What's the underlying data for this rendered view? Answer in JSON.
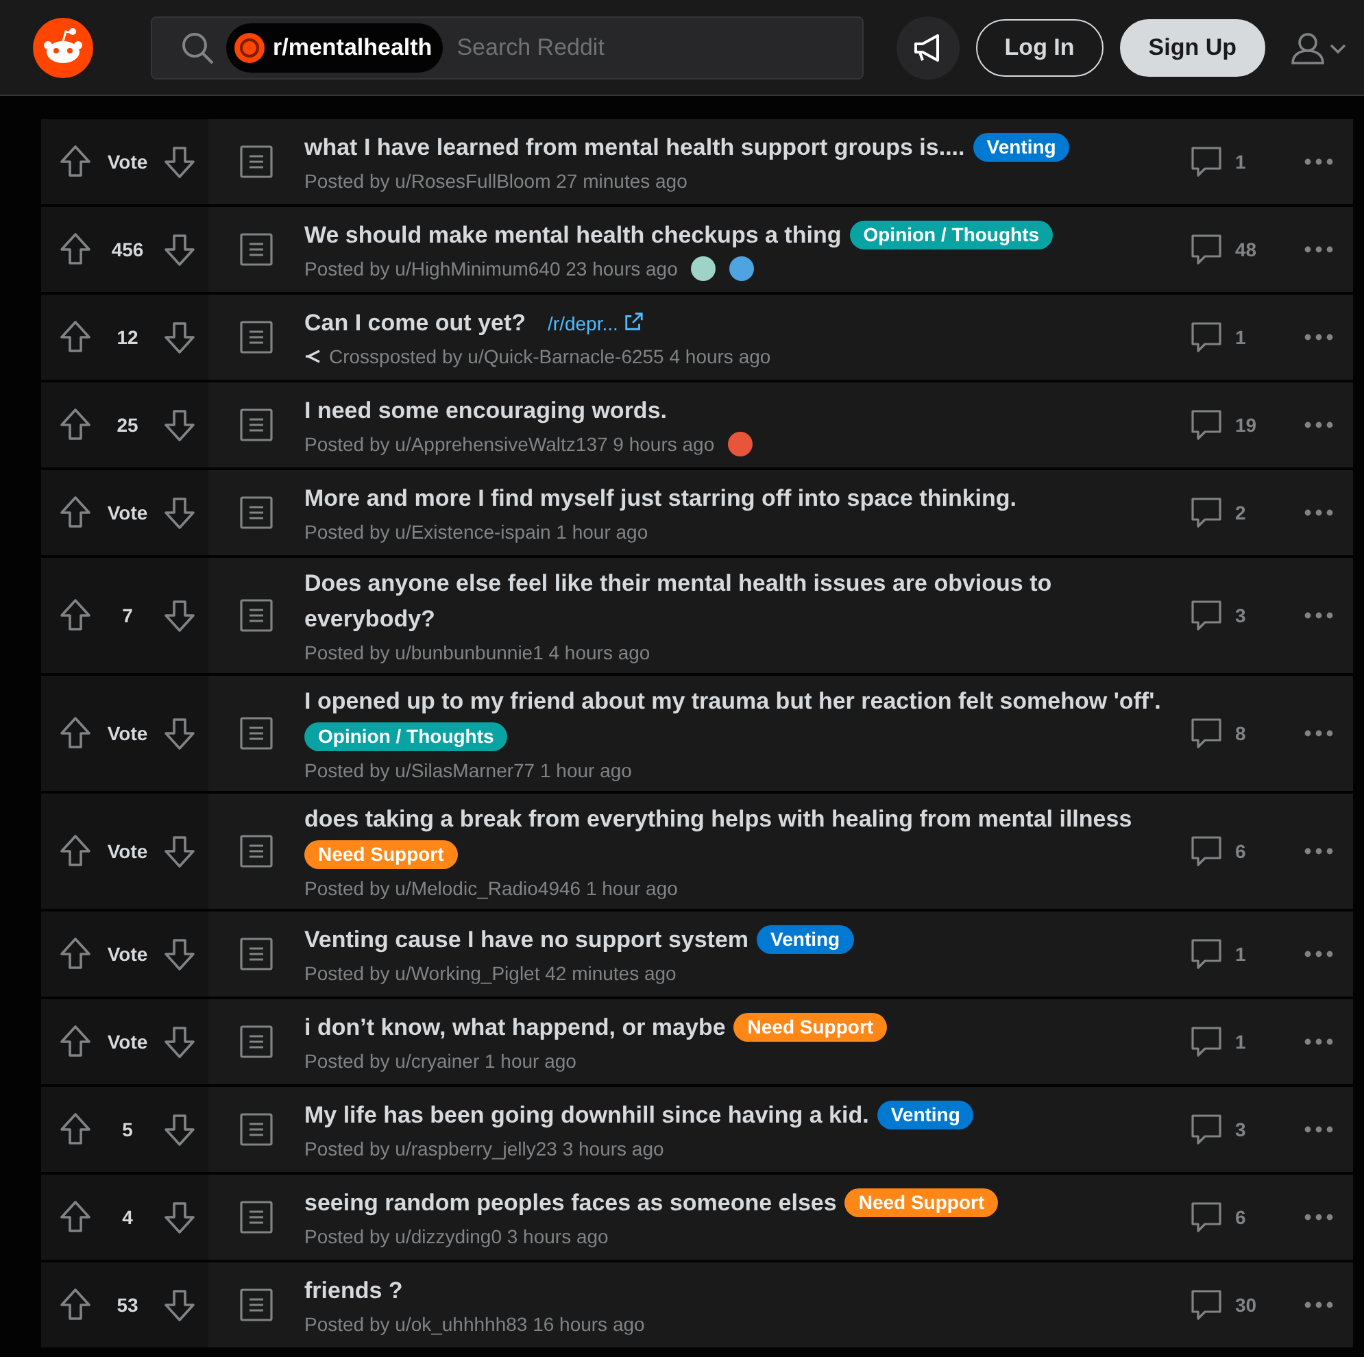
{
  "header": {
    "community": "r/mentalhealth",
    "search": {
      "placeholder": "Search Reddit"
    },
    "buttons": [
      {
        "label": "Log In",
        "kind": "outline"
      },
      {
        "label": "Sign Up",
        "kind": "filled"
      }
    ]
  },
  "posts": [
    {
      "votes": "Vote",
      "title": "what I have learned from mental health support groups is....",
      "flair": {
        "label": "Venting",
        "color": "#0079d3"
      },
      "byline": "Posted by u/RosesFullBloom 27 minutes ago",
      "comments": "1"
    },
    {
      "votes": "456",
      "title": "We should make mental health checkups a thing",
      "flair": {
        "label": "Opinion / Thoughts",
        "color": "#0aa3a3"
      },
      "byline": "Posted by u/HighMinimum640 23 hours ago",
      "awards": [
        {
          "color": "#9fd3c7"
        },
        {
          "color": "#4fa3e0"
        }
      ],
      "comments": "48"
    },
    {
      "votes": "12",
      "title": "Can I come out yet?",
      "link": "/r/depr...",
      "crosspost": true,
      "byline": "Crossposted by u/Quick-Barnacle-6255 4 hours ago",
      "comments": "1"
    },
    {
      "votes": "25",
      "title": "I need some encouraging words.",
      "byline": "Posted by u/ApprehensiveWaltz137 9 hours ago",
      "awards": [
        {
          "color": "#e8553a"
        }
      ],
      "comments": "19"
    },
    {
      "votes": "Vote",
      "title": "More and more I find myself just starring off into space thinking.",
      "byline": "Posted by u/Existence-ispain 1 hour ago",
      "comments": "2"
    },
    {
      "votes": "7",
      "title": "Does anyone else feel like their mental health issues are obvious to everybody?",
      "byline": "Posted by u/bunbunbunnie1 4 hours ago",
      "comments": "3"
    },
    {
      "votes": "Vote",
      "title": "I opened up to my friend about my trauma but her reaction felt somehow 'off'.",
      "flair": {
        "label": "Opinion / Thoughts",
        "color": "#0aa3a3"
      },
      "byline": "Posted by u/SilasMarner77 1 hour ago",
      "comments": "8"
    },
    {
      "votes": "Vote",
      "title": "does taking a break from everything helps with healing from mental illness",
      "flair": {
        "label": "Need Support",
        "color": "#ff8717"
      },
      "byline": "Posted by u/Melodic_Radio4946 1 hour ago",
      "comments": "6"
    },
    {
      "votes": "Vote",
      "title": "Venting cause I have no support system",
      "flair": {
        "label": "Venting",
        "color": "#0079d3"
      },
      "byline": "Posted by u/Working_Piglet 42 minutes ago",
      "comments": "1"
    },
    {
      "votes": "Vote",
      "title": "i don’t know, what happend, or maybe",
      "flair": {
        "label": "Need Support",
        "color": "#ff8717"
      },
      "byline": "Posted by u/cryainer 1 hour ago",
      "comments": "1"
    },
    {
      "votes": "5",
      "title": "My life has been going downhill since having a kid.",
      "flair": {
        "label": "Venting",
        "color": "#0079d3"
      },
      "byline": "Posted by u/raspberry_jelly23 3 hours ago",
      "comments": "3"
    },
    {
      "votes": "4",
      "title": "seeing random peoples faces as someone elses",
      "flair": {
        "label": "Need Support",
        "color": "#ff8717"
      },
      "byline": "Posted by u/dizzyding0 3 hours ago",
      "comments": "6"
    },
    {
      "votes": "53",
      "title": "friends ?",
      "byline": "Posted by u/ok_uhhhhh83 16 hours ago",
      "comments": "30"
    }
  ]
}
